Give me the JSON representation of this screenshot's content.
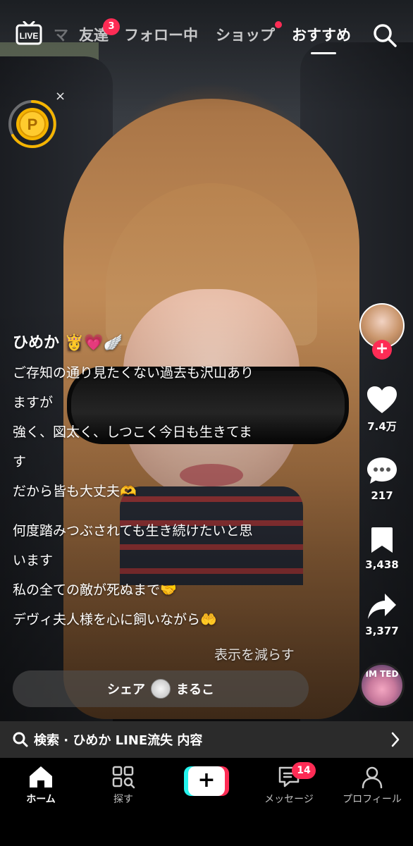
{
  "top_tabs": {
    "partial": "マ",
    "friends": "友達",
    "friends_badge": "3",
    "following": "フォロー中",
    "shop": "ショップ",
    "recommended": "おすすめ",
    "live_label": "LIVE"
  },
  "coin": {
    "letter": "P",
    "close": "×"
  },
  "post": {
    "username": "ひめか",
    "username_emojis": "👸💗🪽",
    "caption_lines": [
      "ご存知の通り見たくない過去も沢山あり",
      "ますが",
      "強く、図太く、しつこく今日も生きてま",
      "す",
      "だから皆も大丈夫🫶",
      "何度踏みつぶされても生き続けたいと思",
      "います",
      "私の全ての敵が死ぬまで🤝",
      "デヴィ夫人様を心に飼いながら🤲"
    ],
    "show_less": "表示を減らす"
  },
  "actions": {
    "likes": "7.4万",
    "comments": "217",
    "saves": "3,438",
    "shares": "3,377",
    "follow": "+",
    "disc_text": "IM TED"
  },
  "share_pill": {
    "label": "シェア",
    "name": "まるこ"
  },
  "search_banner": {
    "text": "検索 · ひめか LINE流失 内容"
  },
  "bottom_nav": {
    "home": "ホーム",
    "discover": "探す",
    "create": "+",
    "messages": "メッセージ",
    "messages_badge": "14",
    "profile": "プロフィール"
  },
  "colors": {
    "accent": "#fe2c55",
    "cyan": "#25f4ee",
    "coin": "#f5b400"
  }
}
